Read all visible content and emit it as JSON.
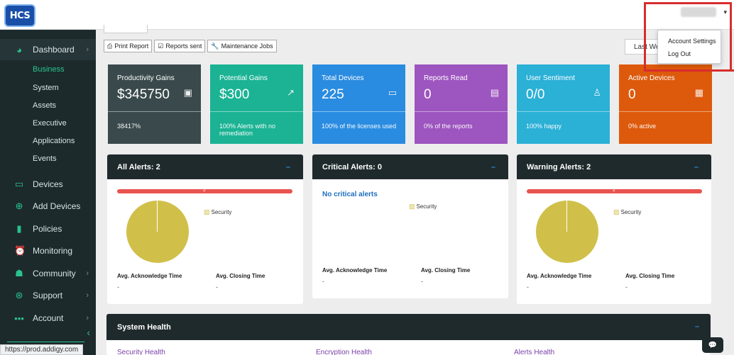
{
  "logo": {
    "text": "HCS"
  },
  "user": {
    "name_redacted": "User Name"
  },
  "sidebar": {
    "items": [
      {
        "label": "Dashboard",
        "icon": "pie-chart-icon",
        "glyph": "◕",
        "chevron": "›"
      },
      {
        "label": "Devices",
        "icon": "monitor-icon",
        "glyph": "▭",
        "chevron": ""
      },
      {
        "label": "Add Devices",
        "icon": "plus-circle-icon",
        "glyph": "⊕",
        "chevron": ""
      },
      {
        "label": "Policies",
        "icon": "briefcase-icon",
        "glyph": "▮",
        "chevron": ""
      },
      {
        "label": "Monitoring",
        "icon": "alarm-clock-icon",
        "glyph": "⏰",
        "chevron": ""
      },
      {
        "label": "Community",
        "icon": "users-icon",
        "glyph": "☗",
        "chevron": "›"
      },
      {
        "label": "Support",
        "icon": "lifebuoy-icon",
        "glyph": "⊛",
        "chevron": "›"
      },
      {
        "label": "Account",
        "icon": "dots-icon",
        "glyph": "•••",
        "chevron": "›"
      }
    ],
    "subitems": [
      "Business",
      "System",
      "Assets",
      "Executive",
      "Applications",
      "Events"
    ],
    "collapse_glyph": "‹"
  },
  "status_url": "https://prod.addigy.com",
  "toolbar": {
    "print": "Print Report",
    "reports_sent": "Reports sent",
    "maintenance": "Maintenance Jobs",
    "period": "Last We"
  },
  "stats": [
    {
      "title": "Productivity Gains",
      "value": "$345750",
      "foot": "38417%",
      "color": "#3a4a4c",
      "icon": "money-icon",
      "glyph": "💵"
    },
    {
      "title": "Potential Gains",
      "value": "$300",
      "foot": "100% Alerts with no remediation",
      "color": "#1bb394",
      "icon": "trend-up-icon",
      "glyph": "📈"
    },
    {
      "title": "Total Devices",
      "value": "225",
      "foot": "100% of the licenses used",
      "color": "#2a8ce0",
      "icon": "monitor-icon",
      "glyph": "🖵"
    },
    {
      "title": "Reports Read",
      "value": "0",
      "foot": "0% of the reports",
      "color": "#9d55bf",
      "icon": "newspaper-icon",
      "glyph": "📰"
    },
    {
      "title": "User Sentiment",
      "value": "0/0",
      "foot": "100% happy",
      "color": "#2bb0d6",
      "icon": "person-icon",
      "glyph": "🕴"
    },
    {
      "title": "Active Devices",
      "value": "0",
      "foot": "0% active",
      "color": "#dd5a0c",
      "icon": "calendar-check-icon",
      "glyph": "📅"
    }
  ],
  "panels": [
    {
      "title": "All Alerts: 2",
      "bar_value": "2",
      "legend": "Security",
      "ack": "Avg. Acknowledge Time",
      "close": "Avg. Closing Time",
      "ack_val": "-",
      "close_val": "-"
    },
    {
      "title": "Critical Alerts: 0",
      "empty_text": "No critical alerts",
      "legend": "Security",
      "ack": "Avg. Acknowledge Time",
      "close": "Avg. Closing Time",
      "ack_val": "-",
      "close_val": "-"
    },
    {
      "title": "Warning Alerts: 2",
      "bar_value": "2",
      "legend": "Security",
      "ack": "Avg. Acknowledge Time",
      "close": "Avg. Closing Time",
      "ack_val": "-",
      "close_val": "-"
    }
  ],
  "minimize_glyph": "–",
  "health": {
    "title": "System Health",
    "labels": [
      "Security Health",
      "Encryption Health",
      "Alerts Health"
    ]
  },
  "dropdown": {
    "settings": "Account Settings",
    "logout": "Log Out"
  },
  "colors": {
    "accent": "#2bc28d",
    "pie": "#d0c04a",
    "bar": "#e9534f",
    "highlight": "#d72d2d"
  }
}
